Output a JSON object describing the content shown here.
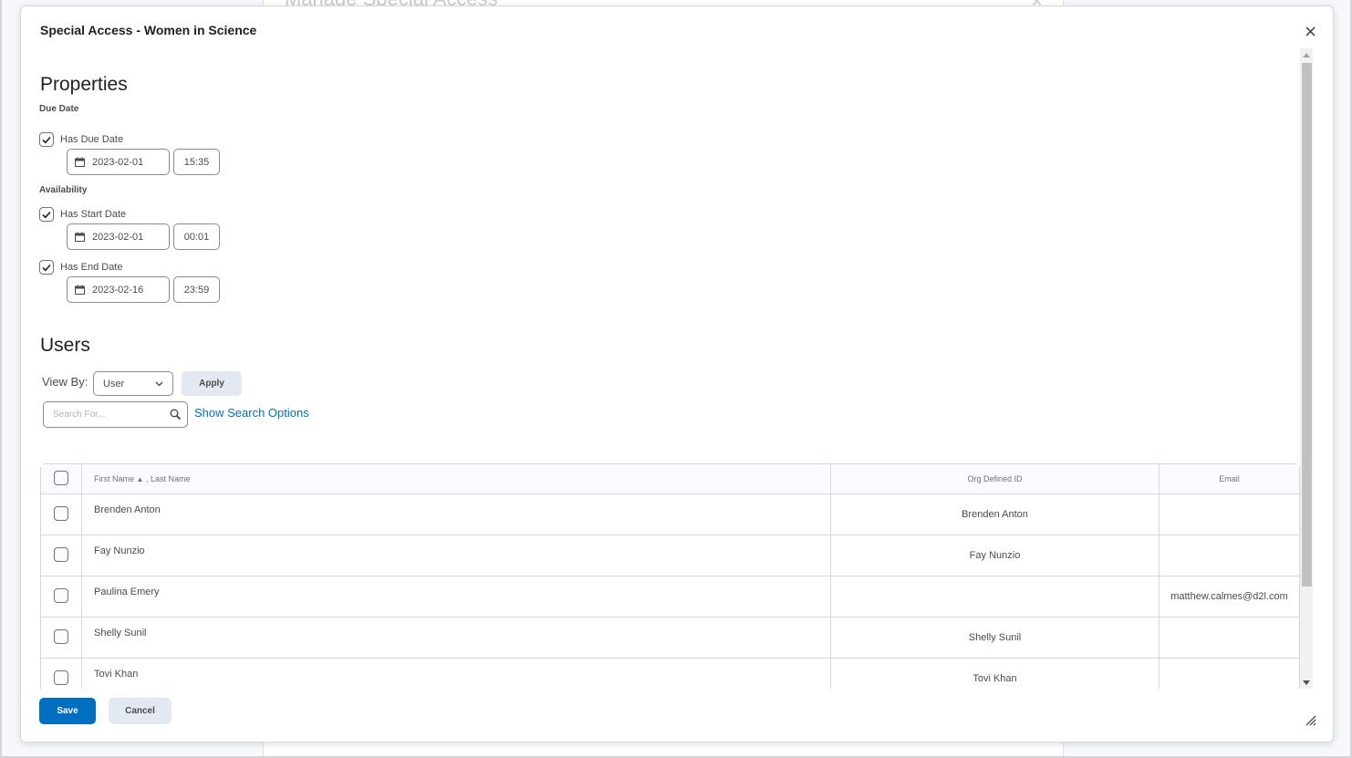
{
  "background": {
    "page_title": "Manage Special Access"
  },
  "dialog": {
    "title": "Special Access - Women in Science",
    "close_icon": "close-icon",
    "properties": {
      "heading": "Properties",
      "due_date": {
        "section_label": "Due Date",
        "has_due_date": {
          "label": "Has Due Date",
          "checked": true,
          "date": "2023-02-01",
          "time": "15:35"
        }
      },
      "availability": {
        "section_label": "Availability",
        "has_start_date": {
          "label": "Has Start Date",
          "checked": true,
          "date": "2023-02-01",
          "time": "00:01"
        },
        "has_end_date": {
          "label": "Has End Date",
          "checked": true,
          "date": "2023-02-16",
          "time": "23:59"
        }
      }
    },
    "users": {
      "heading": "Users",
      "view_by_label": "View By:",
      "view_by_value": "User",
      "apply_label": "Apply",
      "search_placeholder": "Search For...",
      "show_search_options": "Show Search Options",
      "table": {
        "columns": {
          "name": "First Name",
          "name_sort_indicator": "▲",
          "name_secondary": ", Last Name",
          "org_id": "Org Defined ID",
          "email": "Email"
        },
        "rows": [
          {
            "name": "Brenden Anton",
            "org_id": "Brenden Anton",
            "email": ""
          },
          {
            "name": "Fay Nunzio",
            "org_id": "Fay Nunzio",
            "email": ""
          },
          {
            "name": "Paulina Emery",
            "org_id": "",
            "email": "matthew.calmes@d2l.com"
          },
          {
            "name": "Shelly Sunil",
            "org_id": "Shelly Sunil",
            "email": ""
          },
          {
            "name": "Tovi Khan",
            "org_id": "Tovi Khan",
            "email": ""
          }
        ]
      }
    },
    "footer": {
      "save_label": "Save",
      "cancel_label": "Cancel"
    }
  },
  "colors": {
    "primary": "#006fbf",
    "secondary_button": "#e3e9f1",
    "link": "#006fbf"
  }
}
